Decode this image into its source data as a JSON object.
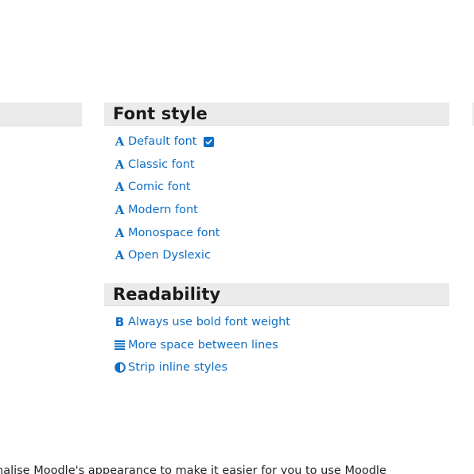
{
  "font_style": {
    "title": "Font style",
    "items": [
      {
        "label": "Default font",
        "icon": "font-a-icon",
        "selected": true
      },
      {
        "label": "Classic font",
        "icon": "font-a-icon",
        "selected": false
      },
      {
        "label": "Comic font",
        "icon": "font-a-icon",
        "selected": false
      },
      {
        "label": "Modern font",
        "icon": "font-a-icon",
        "selected": false
      },
      {
        "label": "Monospace font",
        "icon": "font-a-icon",
        "selected": false
      },
      {
        "label": "Open Dyslexic",
        "icon": "font-a-icon",
        "selected": false
      }
    ],
    "icon_glyph": "A"
  },
  "readability": {
    "title": "Readability",
    "items": [
      {
        "label": "Always use bold font weight",
        "icon": "bold-b-icon",
        "glyph": "B"
      },
      {
        "label": "More space between lines",
        "icon": "line-spacing-icon"
      },
      {
        "label": "Strip inline styles",
        "icon": "contrast-half-circle-icon"
      }
    ]
  },
  "footer": {
    "text": "nalise Moodle's appearance to make it easier for you to use Moodle"
  },
  "colors": {
    "link": "#0f6fc5",
    "header_bg": "#ebebeb",
    "text": "#1d2125"
  }
}
